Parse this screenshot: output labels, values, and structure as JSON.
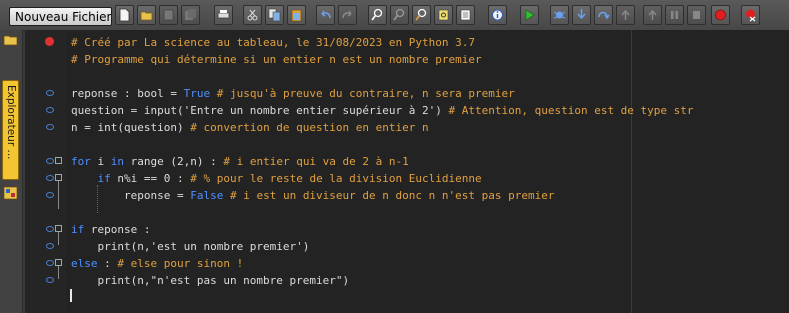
{
  "toolbar": {
    "new_file_label": "Nouveau Fichier...",
    "buttons": [
      "new-document-icon",
      "open-folder-icon",
      "save-icon",
      "save-all-icon",
      "print-icon",
      "cut-icon",
      "copy-icon",
      "paste-icon",
      "undo-icon",
      "redo-icon",
      "search-icon",
      "search-next-icon",
      "replace-icon",
      "goto-icon",
      "select-all-icon",
      "info-icon",
      "run-icon",
      "debug-icon",
      "step-into-icon",
      "step-over-icon",
      "step-out-icon",
      "step-back-icon",
      "pause-icon",
      "stop-icon",
      "breakpoint-icon",
      "clear-breakpoints-icon"
    ]
  },
  "sidebar": {
    "explorer_tab_label": "Explorateur ..."
  },
  "editor": {
    "lines": [
      {
        "segments": [
          {
            "t": "# Créé par La science au tableau, le 31/08/2023 en Python 3.7",
            "c": "cmt"
          }
        ]
      },
      {
        "segments": [
          {
            "t": "# Programme qui détermine si un entier n est un nombre premier",
            "c": "cmt"
          }
        ]
      },
      {
        "segments": []
      },
      {
        "segments": [
          {
            "t": "reponse : bool = ",
            "c": ""
          },
          {
            "t": "True",
            "c": "kw"
          },
          {
            "t": " # jusqu'à preuve du contraire, n sera premier",
            "c": "cmt"
          }
        ]
      },
      {
        "segments": [
          {
            "t": "question = input('Entre un nombre entier supérieur à 2') ",
            "c": ""
          },
          {
            "t": "# Attention, question est de type str",
            "c": "cmt"
          }
        ]
      },
      {
        "segments": [
          {
            "t": "n = int(question) ",
            "c": ""
          },
          {
            "t": "# convertion de question en entier n",
            "c": "cmt"
          }
        ]
      },
      {
        "segments": []
      },
      {
        "segments": [
          {
            "t": "for",
            "c": "kw"
          },
          {
            "t": " i ",
            "c": ""
          },
          {
            "t": "in",
            "c": "kw"
          },
          {
            "t": " range (2,n) : ",
            "c": ""
          },
          {
            "t": "# i entier qui va de 2 à n-1",
            "c": "cmt"
          }
        ]
      },
      {
        "segments": [
          {
            "t": "    ",
            "c": ""
          },
          {
            "t": "if",
            "c": "kw"
          },
          {
            "t": " n%i == 0 : ",
            "c": ""
          },
          {
            "t": "# % pour le reste de la division Euclidienne",
            "c": "cmt"
          }
        ]
      },
      {
        "segments": [
          {
            "t": "        reponse = ",
            "c": ""
          },
          {
            "t": "False",
            "c": "kw"
          },
          {
            "t": " # i est un diviseur de n donc n n'est pas premier",
            "c": "cmt"
          }
        ]
      },
      {
        "segments": []
      },
      {
        "segments": [
          {
            "t": "if",
            "c": "kw"
          },
          {
            "t": " reponse :",
            "c": ""
          }
        ]
      },
      {
        "segments": [
          {
            "t": "    print(n,'est un nombre premier')",
            "c": ""
          }
        ]
      },
      {
        "segments": [
          {
            "t": "else",
            "c": "kw"
          },
          {
            "t": " : ",
            "c": ""
          },
          {
            "t": "# else pour sinon !",
            "c": "cmt"
          }
        ]
      },
      {
        "segments": [
          {
            "t": "    print(n,\"n'est pas un nombre premier\")",
            "c": ""
          }
        ]
      }
    ]
  },
  "colors": {
    "comment": "#e0a040",
    "keyword": "#4f8fff",
    "marker": "#4a7fd0",
    "error": "#e03030"
  }
}
